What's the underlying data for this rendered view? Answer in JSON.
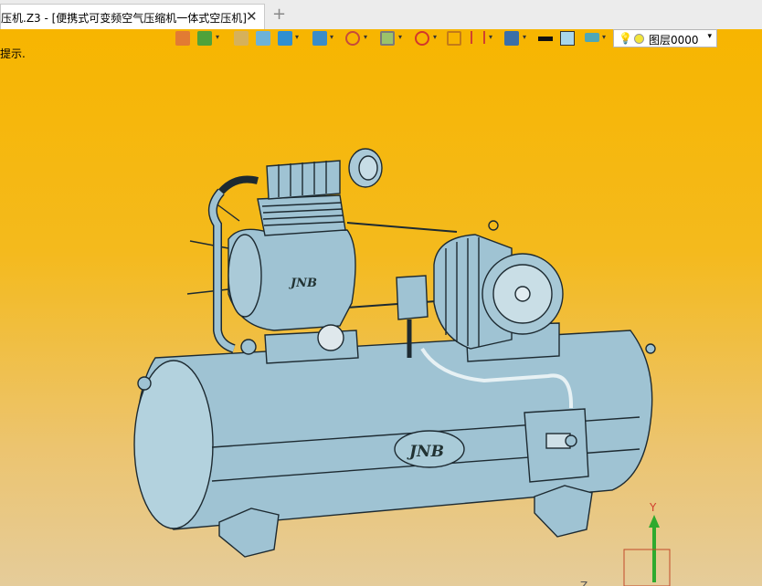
{
  "window": {
    "tab_title": "压机.Z3 - [便携式可变频空气压缩机一体式空压机]",
    "close_glyph": "✕",
    "new_tab_glyph": "+"
  },
  "viewport": {
    "hint": "提示.",
    "background_top": "#f7b500",
    "background_bottom": "#e5cc9a"
  },
  "toolbar": {
    "layer_name": "图层0000",
    "layer_arrow": "▾",
    "dropdown_glyph": "▾",
    "items": [
      {
        "icon": "exit-icon"
      },
      {
        "icon": "paint-bucket-icon"
      },
      {
        "icon": "pen-icon"
      },
      {
        "icon": "cube-icon"
      },
      {
        "icon": "solid-view-icon"
      },
      {
        "icon": "view-cube-icon"
      },
      {
        "icon": "render-wheel-icon"
      },
      {
        "icon": "frame-icon"
      },
      {
        "icon": "crosshair-icon"
      },
      {
        "icon": "dimension-icon"
      },
      {
        "icon": "bracket-icon"
      },
      {
        "icon": "display-icon"
      },
      {
        "icon": "line-style-icon"
      },
      {
        "icon": "color-swatch-icon"
      },
      {
        "icon": "layers-icon"
      }
    ]
  },
  "model": {
    "tank_brand": "JNB",
    "head_brand": "JNB",
    "axis_y": "Y",
    "axis_z": "Z",
    "body_color": "#9fc3d3",
    "edge_color": "#1d2a31"
  }
}
